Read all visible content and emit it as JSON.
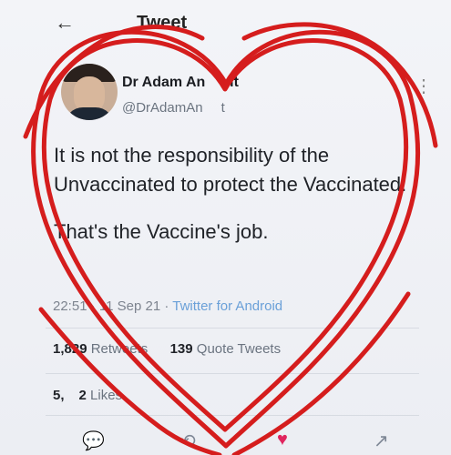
{
  "header": {
    "back_icon": "arrow-left-icon",
    "title": "Tweet"
  },
  "author": {
    "name": "Dr Adam An",
    "name_tail": "vit",
    "handle": "@DrAdamAn",
    "handle_tail": "t"
  },
  "tweet": {
    "paragraph_1": "It is not the responsibility of the Unvaccinated to protect the Vaccinated.",
    "paragraph_2": "That's the Vaccine's job."
  },
  "meta": {
    "time": "22:51",
    "date": "11 Sep 21",
    "app": "Twitter for Android"
  },
  "stats": {
    "retweets": "1,829",
    "retweets_label": "Retweets",
    "quote_tweets": "139",
    "quote_tweets_label": "Quote Tweets",
    "likes": "5,",
    "likes_tail": "2",
    "likes_label": "Likes"
  },
  "actions": {
    "reply_icon": "reply-icon",
    "retweet_icon": "retweet-icon",
    "like_icon": "heart-icon",
    "share_icon": "share-icon"
  },
  "colors": {
    "background": "#eef0f4",
    "accent": "#6aa0d8",
    "heart": "#e0245e",
    "annotation": "#d51d1d"
  }
}
